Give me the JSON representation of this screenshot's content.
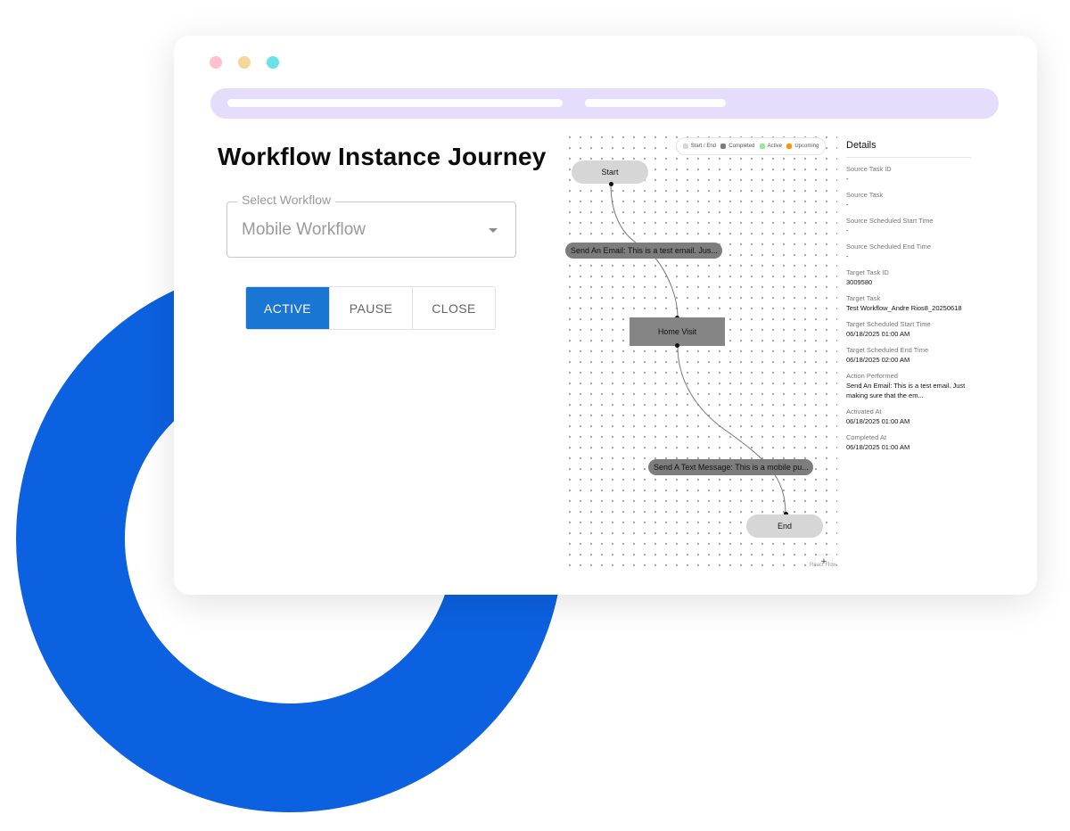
{
  "page": {
    "title": "Workflow Instance Journey"
  },
  "select_workflow": {
    "label": "Select Workflow",
    "value": "Mobile Workflow"
  },
  "status_buttons": {
    "active": "ACTIVE",
    "pause": "PAUSE",
    "close": "CLOSE",
    "selected": "ACTIVE"
  },
  "flow": {
    "legend": [
      {
        "label": "Start / End",
        "color": "#d6d6d6"
      },
      {
        "label": "Completed",
        "color": "#7d7d7d"
      },
      {
        "label": "Active",
        "color": "#90ee90"
      },
      {
        "label": "Upcoming",
        "color": "#ff9800"
      }
    ],
    "nodes": {
      "start": "Start",
      "send_email": "Send An Email: This is a test email. Jus...",
      "home_visit": "Home Visit",
      "send_text": "Send A Text Message: This is a mobile pu...",
      "end": "End"
    },
    "zoom": {
      "in": "+",
      "out": "−",
      "fit": "⛶"
    },
    "attribution": "React Flow"
  },
  "details": {
    "title": "Details",
    "fields": [
      {
        "label": "Source Task ID",
        "value": "-"
      },
      {
        "label": "Source Task",
        "value": "-"
      },
      {
        "label": "Source Scheduled Start Time",
        "value": "-"
      },
      {
        "label": "Source Scheduled End Time",
        "value": "-"
      },
      {
        "label": "Target Task ID",
        "value": "3009580"
      },
      {
        "label": "Target Task",
        "value": "Test Workflow_Andre Rios8_20250618"
      },
      {
        "label": "Target Scheduled Start Time",
        "value": "06/18/2025 01:00 AM"
      },
      {
        "label": "Target Scheduled End Time",
        "value": "06/18/2025 02:00 AM"
      },
      {
        "label": "Action Performed",
        "value": "Send An Email: This is a test email. Just making sure that the em..."
      },
      {
        "label": "Activated At",
        "value": "06/18/2025 01:00 AM"
      },
      {
        "label": "Completed At",
        "value": "06/18/2025 01:00 AM"
      }
    ]
  },
  "colors": {
    "accent": "#1976d2",
    "ring": "#0c61e0",
    "urlbar": "#e6dcfb"
  }
}
